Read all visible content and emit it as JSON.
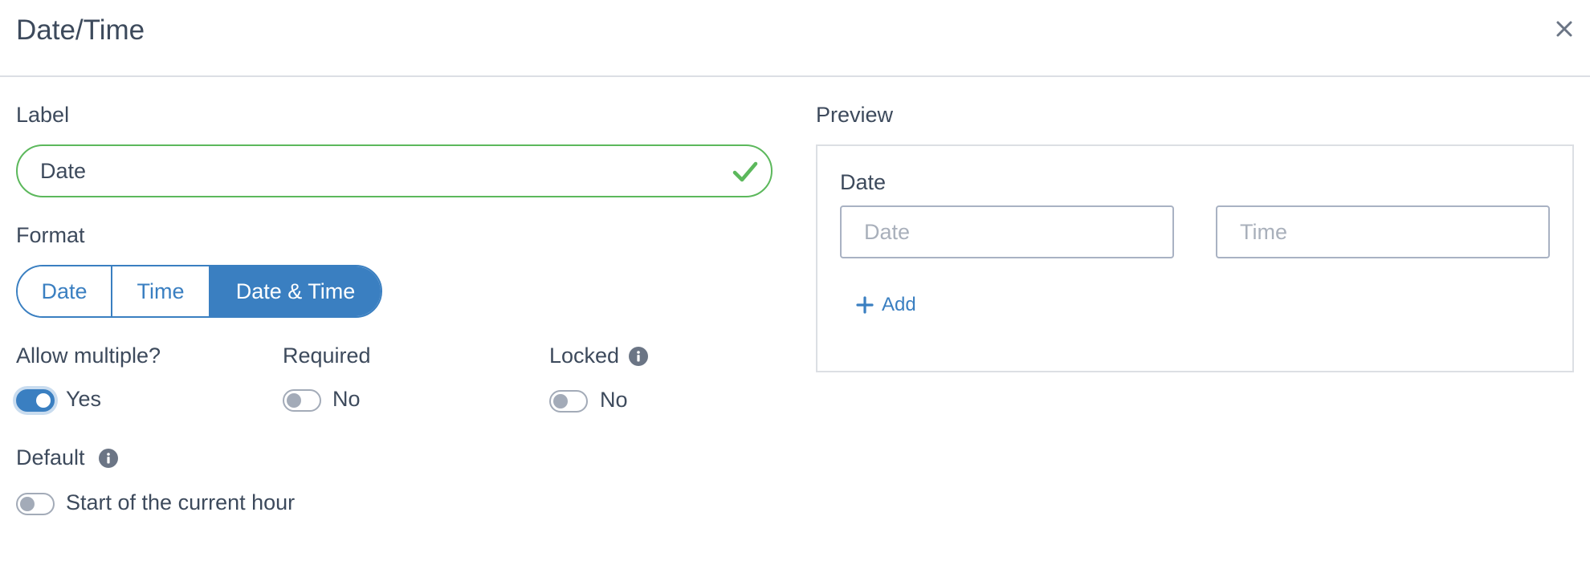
{
  "dialog": {
    "title": "Date/Time"
  },
  "label_field": {
    "heading": "Label",
    "value": "Date"
  },
  "format": {
    "heading": "Format",
    "options": [
      "Date",
      "Time",
      "Date & Time"
    ],
    "selected": "Date & Time"
  },
  "allow_multiple": {
    "heading": "Allow multiple?",
    "enabled": true,
    "state_text": "Yes"
  },
  "required": {
    "heading": "Required",
    "enabled": false,
    "state_text": "No"
  },
  "locked": {
    "heading": "Locked",
    "enabled": false,
    "state_text": "No"
  },
  "default": {
    "heading": "Default",
    "enabled": false,
    "state_text": "Start of the current hour"
  },
  "preview": {
    "heading": "Preview",
    "field_label": "Date",
    "date_placeholder": "Date",
    "time_placeholder": "Time",
    "add_label": "Add"
  },
  "colors": {
    "accent": "#3a7fc1",
    "success": "#5cb85c",
    "text": "#3d4a5c",
    "muted": "#a3abb8"
  },
  "icons": [
    "close-icon",
    "check-icon",
    "info-icon",
    "plus-icon"
  ]
}
